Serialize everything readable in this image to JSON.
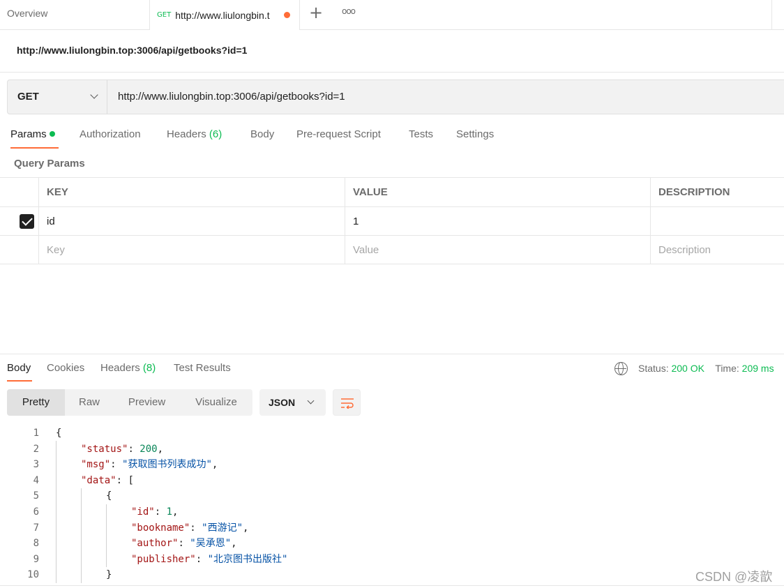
{
  "tabs": {
    "overview": "Overview",
    "active_method": "GET",
    "active_url": "http://www.liulongbin.t",
    "plus": "+",
    "more": "ooo"
  },
  "request": {
    "title": "http://www.liulongbin.top:3006/api/getbooks?id=1",
    "method": "GET",
    "url": "http://www.liulongbin.top:3006/api/getbooks?id=1"
  },
  "request_tabs": {
    "params": "Params",
    "authorization": "Authorization",
    "headers": "Headers",
    "headers_count": "(6)",
    "body": "Body",
    "prerequest": "Pre-request Script",
    "tests": "Tests",
    "settings": "Settings"
  },
  "query_params": {
    "label": "Query Params",
    "headers": {
      "key": "KEY",
      "value": "VALUE",
      "description": "DESCRIPTION"
    },
    "row": {
      "key": "id",
      "value": "1",
      "description": ""
    },
    "placeholders": {
      "key": "Key",
      "value": "Value",
      "description": "Description"
    }
  },
  "response_tabs": {
    "body": "Body",
    "cookies": "Cookies",
    "headers": "Headers",
    "headers_count": "(8)",
    "test_results": "Test Results"
  },
  "status": {
    "status_label": "Status:",
    "status_value": "200 OK",
    "time_label": "Time:",
    "time_value": "209 ms"
  },
  "view_modes": {
    "pretty": "Pretty",
    "raw": "Raw",
    "preview": "Preview",
    "visualize": "Visualize",
    "format": "JSON"
  },
  "code_lines": [
    {
      "n": "1",
      "open": "{"
    },
    {
      "n": "2",
      "key": "\"status\"",
      "sep": ": ",
      "num": "200",
      "end": ","
    },
    {
      "n": "3",
      "key": "\"msg\"",
      "sep": ": ",
      "str": "\"获取图书列表成功\"",
      "end": ","
    },
    {
      "n": "4",
      "key": "\"data\"",
      "sep": ": ",
      "end": "["
    },
    {
      "n": "5",
      "open": "{"
    },
    {
      "n": "6",
      "key": "\"id\"",
      "sep": ": ",
      "num": "1",
      "end": ","
    },
    {
      "n": "7",
      "key": "\"bookname\"",
      "sep": ": ",
      "str": "\"西游记\"",
      "end": ","
    },
    {
      "n": "8",
      "key": "\"author\"",
      "sep": ": ",
      "str": "\"吴承恩\"",
      "end": ","
    },
    {
      "n": "9",
      "key": "\"publisher\"",
      "sep": ": ",
      "str": "\"北京图书出版社\"",
      "end": ""
    },
    {
      "n": "10",
      "open": "}"
    }
  ],
  "watermark": "CSDN @凌歆",
  "colors": {
    "accent": "#ff6c37",
    "success": "#0cbb52",
    "json_key": "#a31515",
    "json_number": "#098658",
    "json_string": "#0451a5"
  }
}
